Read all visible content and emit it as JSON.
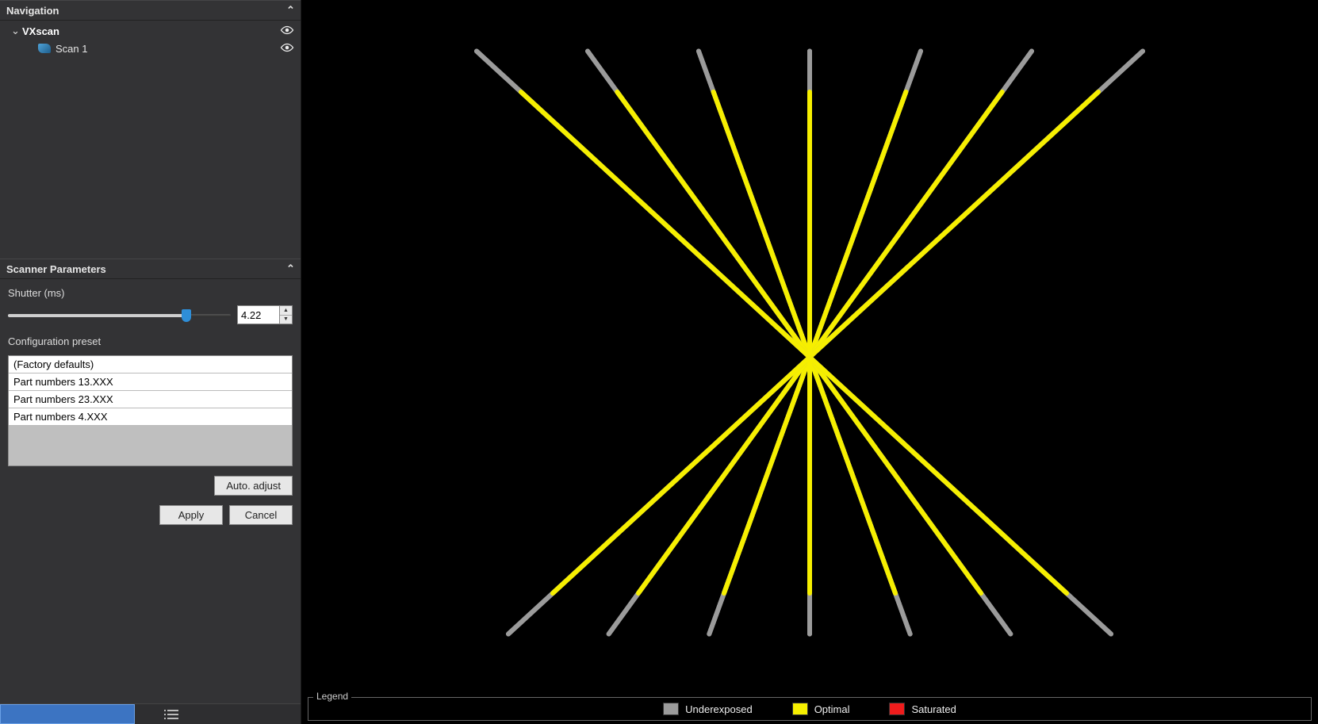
{
  "nav": {
    "title": "Navigation",
    "root_label": "VXscan",
    "items": [
      "Scan 1"
    ]
  },
  "params": {
    "title": "Scanner Parameters",
    "shutter_label": "Shutter (ms)",
    "shutter_value": "4.22",
    "preset_label": "Configuration preset",
    "presets": [
      "(Factory defaults)",
      "Part numbers 13.XXX",
      "Part numbers 23.XXX",
      "Part numbers 4.XXX"
    ],
    "auto_adjust": "Auto. adjust",
    "apply": "Apply",
    "cancel": "Cancel"
  },
  "legend": {
    "title": "Legend",
    "items": [
      {
        "label": "Underexposed",
        "color": "#9b9b9b"
      },
      {
        "label": "Optimal",
        "color": "#f6ef00"
      },
      {
        "label": "Saturated",
        "color": "#ef1c1c"
      }
    ]
  },
  "colors": {
    "underexposed": "#9b9b9b",
    "optimal": "#f6ef00"
  }
}
